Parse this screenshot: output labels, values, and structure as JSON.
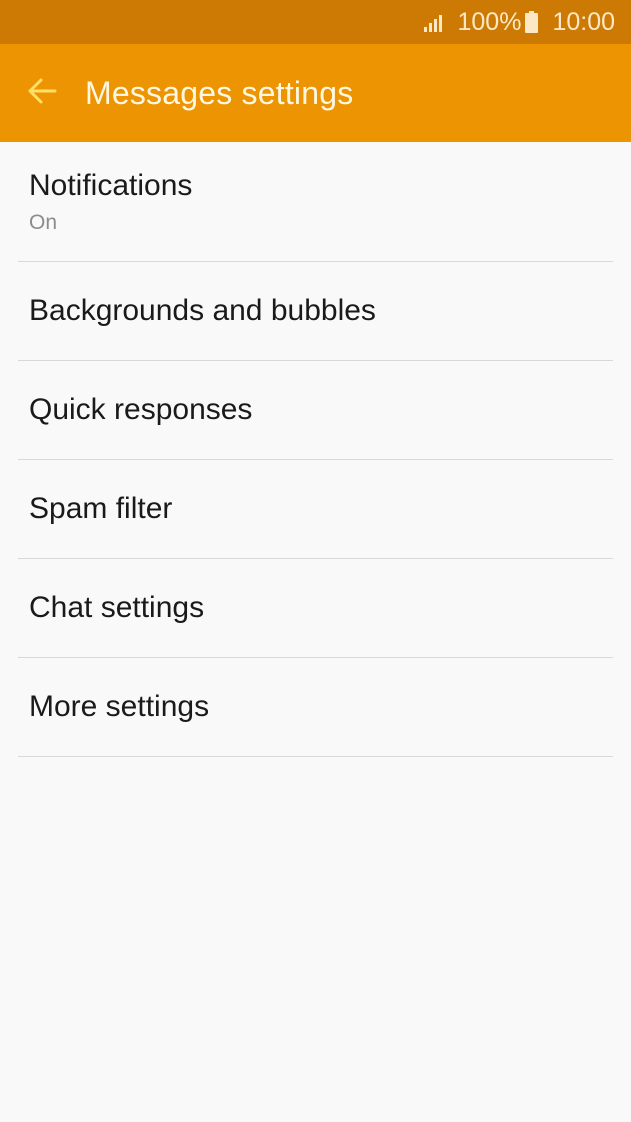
{
  "status_bar": {
    "battery_percent": "100%",
    "time": "10:00",
    "signal_icon": "signal-icon",
    "battery_icon": "battery-icon"
  },
  "app_bar": {
    "title": "Messages settings",
    "back_icon": "arrow-left-icon",
    "colors": {
      "status_bar": "#cc7a04",
      "app_bar": "#ec9401",
      "back_arrow": "#ffe066"
    }
  },
  "settings": {
    "items": [
      {
        "label": "Notifications",
        "sub": "On"
      },
      {
        "label": "Backgrounds and bubbles"
      },
      {
        "label": "Quick responses"
      },
      {
        "label": "Spam filter"
      },
      {
        "label": "Chat settings"
      },
      {
        "label": "More settings"
      }
    ]
  }
}
